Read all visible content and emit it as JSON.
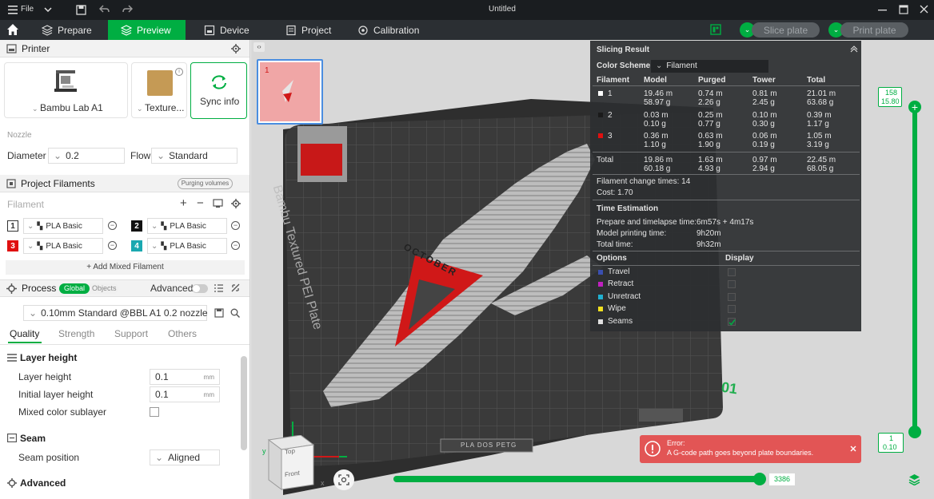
{
  "titlebar": {
    "menu_label": "File",
    "title": "Untitled"
  },
  "nav": {
    "tabs": [
      "Prepare",
      "Preview",
      "Device",
      "Project",
      "Calibration"
    ],
    "active": "Preview",
    "slice_label": "Slice plate",
    "print_label": "Print plate"
  },
  "printer": {
    "section_title": "Printer",
    "model": "Bambu Lab A1",
    "plate": "Texture...",
    "sync_label": "Sync info",
    "nozzle_label": "Nozzle",
    "diameter_label": "Diameter",
    "diameter_value": "0.2",
    "flow_label": "Flow",
    "flow_value": "Standard"
  },
  "filaments": {
    "section_title": "Project Filaments",
    "purge_label": "Purging volumes",
    "filament_label": "Filament",
    "items": [
      {
        "num": "1",
        "name": "PLA Basic",
        "color": "#ffffff"
      },
      {
        "num": "2",
        "name": "PLA Basic",
        "color": "#111111"
      },
      {
        "num": "3",
        "name": "PLA Basic",
        "color": "#e01010"
      },
      {
        "num": "4",
        "name": "PLA Basic",
        "color": "#1aa8b0"
      }
    ],
    "add_mixed": "+ Add Mixed Filament"
  },
  "process": {
    "section_title": "Process",
    "global_label": "Global",
    "objects_label": "Objects",
    "advanced_label": "Advanced",
    "preset": "0.10mm Standard @BBL A1 0.2 nozzle",
    "tabs": [
      "Quality",
      "Strength",
      "Support",
      "Others"
    ],
    "layer_group": "Layer height",
    "layer_height_label": "Layer height",
    "layer_height_value": "0.1",
    "initial_layer_label": "Initial layer height",
    "initial_layer_value": "0.1",
    "unit": "mm",
    "mixed_sublayer_label": "Mixed color sublayer",
    "seam_group": "Seam",
    "seam_position_label": "Seam position",
    "seam_position_value": "Aligned",
    "advanced_group": "Advanced"
  },
  "plate_thumb": {
    "index": "1"
  },
  "bed": {
    "label": "Bambu Textured PEI Plate",
    "plate_number": "01",
    "model_text": "OCTOBER",
    "plate_tag": "PLA DOS PETG"
  },
  "cube": {
    "top": "Top",
    "front": "Front",
    "x": "x",
    "y": "y"
  },
  "result": {
    "title": "Slicing Result",
    "scheme_label": "Color Scheme",
    "scheme_value": "Filament",
    "headers": [
      "Filament",
      "Model",
      "Purged",
      "Tower",
      "Total"
    ],
    "rows": [
      {
        "id": "1",
        "color": "#ffffff",
        "model": [
          "19.46 m",
          "58.97 g"
        ],
        "purged": [
          "0.74 m",
          "2.26 g"
        ],
        "tower": [
          "0.81 m",
          "2.45 g"
        ],
        "total": [
          "21.01 m",
          "63.68 g"
        ]
      },
      {
        "id": "2",
        "color": "#1a1a1a",
        "model": [
          "0.03 m",
          "0.10 g"
        ],
        "purged": [
          "0.25 m",
          "0.77 g"
        ],
        "tower": [
          "0.10 m",
          "0.30 g"
        ],
        "total": [
          "0.39 m",
          "1.17 g"
        ]
      },
      {
        "id": "3",
        "color": "#e01010",
        "model": [
          "0.36 m",
          "1.10 g"
        ],
        "purged": [
          "0.63 m",
          "1.90 g"
        ],
        "tower": [
          "0.06 m",
          "0.19 g"
        ],
        "total": [
          "1.05 m",
          "3.19 g"
        ]
      }
    ],
    "total_row": {
      "label": "Total",
      "model": [
        "19.86 m",
        "60.18 g"
      ],
      "purged": [
        "1.63 m",
        "4.93 g"
      ],
      "tower": [
        "0.97 m",
        "2.94 g"
      ],
      "total": [
        "22.45 m",
        "68.05 g"
      ]
    },
    "change_times": "Filament change times:  14",
    "cost": "Cost:  1.70",
    "time_title": "Time Estimation",
    "prepare_label": "Prepare and timelapse time:",
    "prepare_value": "6m57s + 4m17s",
    "model_time_label": "Model printing time:",
    "model_time_value": "9h20m",
    "total_time_label": "Total time:",
    "total_time_value": "9h32m",
    "options_label": "Options",
    "display_label": "Display",
    "options": [
      {
        "name": "Travel",
        "color": "#3a4fb0",
        "checked": false
      },
      {
        "name": "Retract",
        "color": "#c020c0",
        "checked": false
      },
      {
        "name": "Unretract",
        "color": "#20b0d0",
        "checked": false
      },
      {
        "name": "Wipe",
        "color": "#f0e020",
        "checked": false
      },
      {
        "name": "Seams",
        "color": "#e0e0e0",
        "checked": true
      }
    ]
  },
  "error": {
    "title": "Error:",
    "message": "A G-code path goes beyond plate boundaries."
  },
  "layer_slider": {
    "top_layer": "158",
    "top_height": "15.80",
    "bottom_layer": "1",
    "bottom_height": "0.10"
  },
  "move_slider": {
    "value": "3386"
  }
}
